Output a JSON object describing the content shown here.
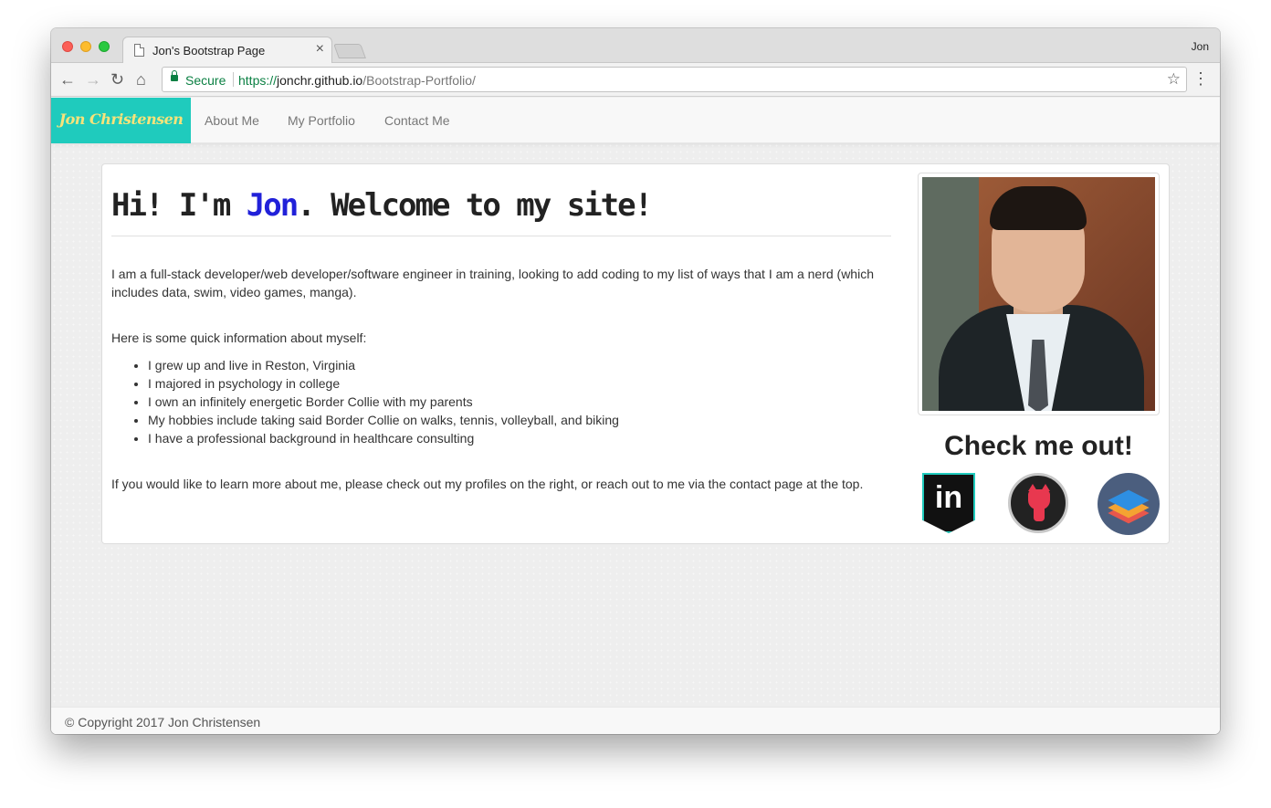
{
  "browser": {
    "tab_title": "Jon's Bootstrap Page",
    "tab_close": "×",
    "profile_name": "Jon",
    "secure_label": "Secure",
    "url_scheme": "https://",
    "url_host": "jonchr.github.io",
    "url_path": "/Bootstrap-Portfolio/",
    "icons": {
      "back": "←",
      "forward": "→",
      "reload": "↻",
      "home": "⌂",
      "star": "☆",
      "menu": "⋮"
    }
  },
  "navbar": {
    "brand": "Jon Christensen",
    "links": [
      "About Me",
      "My Portfolio",
      "Contact Me"
    ],
    "brand_bg": "#1fcbbd",
    "brand_color": "#f7e37a"
  },
  "main": {
    "headline_before": "Hi! I'm ",
    "headline_name": "Jon",
    "headline_after": ". Welcome to my site!",
    "intro": "I am a full-stack developer/web developer/software engineer in training, looking to add coding to my list of ways that I am a nerd (which includes data, swim, video games, manga).",
    "info_heading": "Here is some quick information about myself:",
    "facts": [
      "I grew up and live in Reston, Virginia",
      "I majored in psychology in college",
      "I own an infinitely energetic Border Collie with my parents",
      "My hobbies include taking said Border Collie on walks, tennis, volleyball, and biking",
      "I have a professional background in healthcare consulting"
    ],
    "outro": "If you would like to learn more about me, please check out my profiles on the right, or reach out to me via the contact page at the top."
  },
  "sidebar": {
    "check_heading": "Check me out!",
    "linkedin_label": "in",
    "social_icons": [
      "linkedin-icon",
      "github-icon",
      "stackoverflow-icon"
    ]
  },
  "footer": {
    "copyright": "© Copyright 2017 Jon Christensen"
  }
}
